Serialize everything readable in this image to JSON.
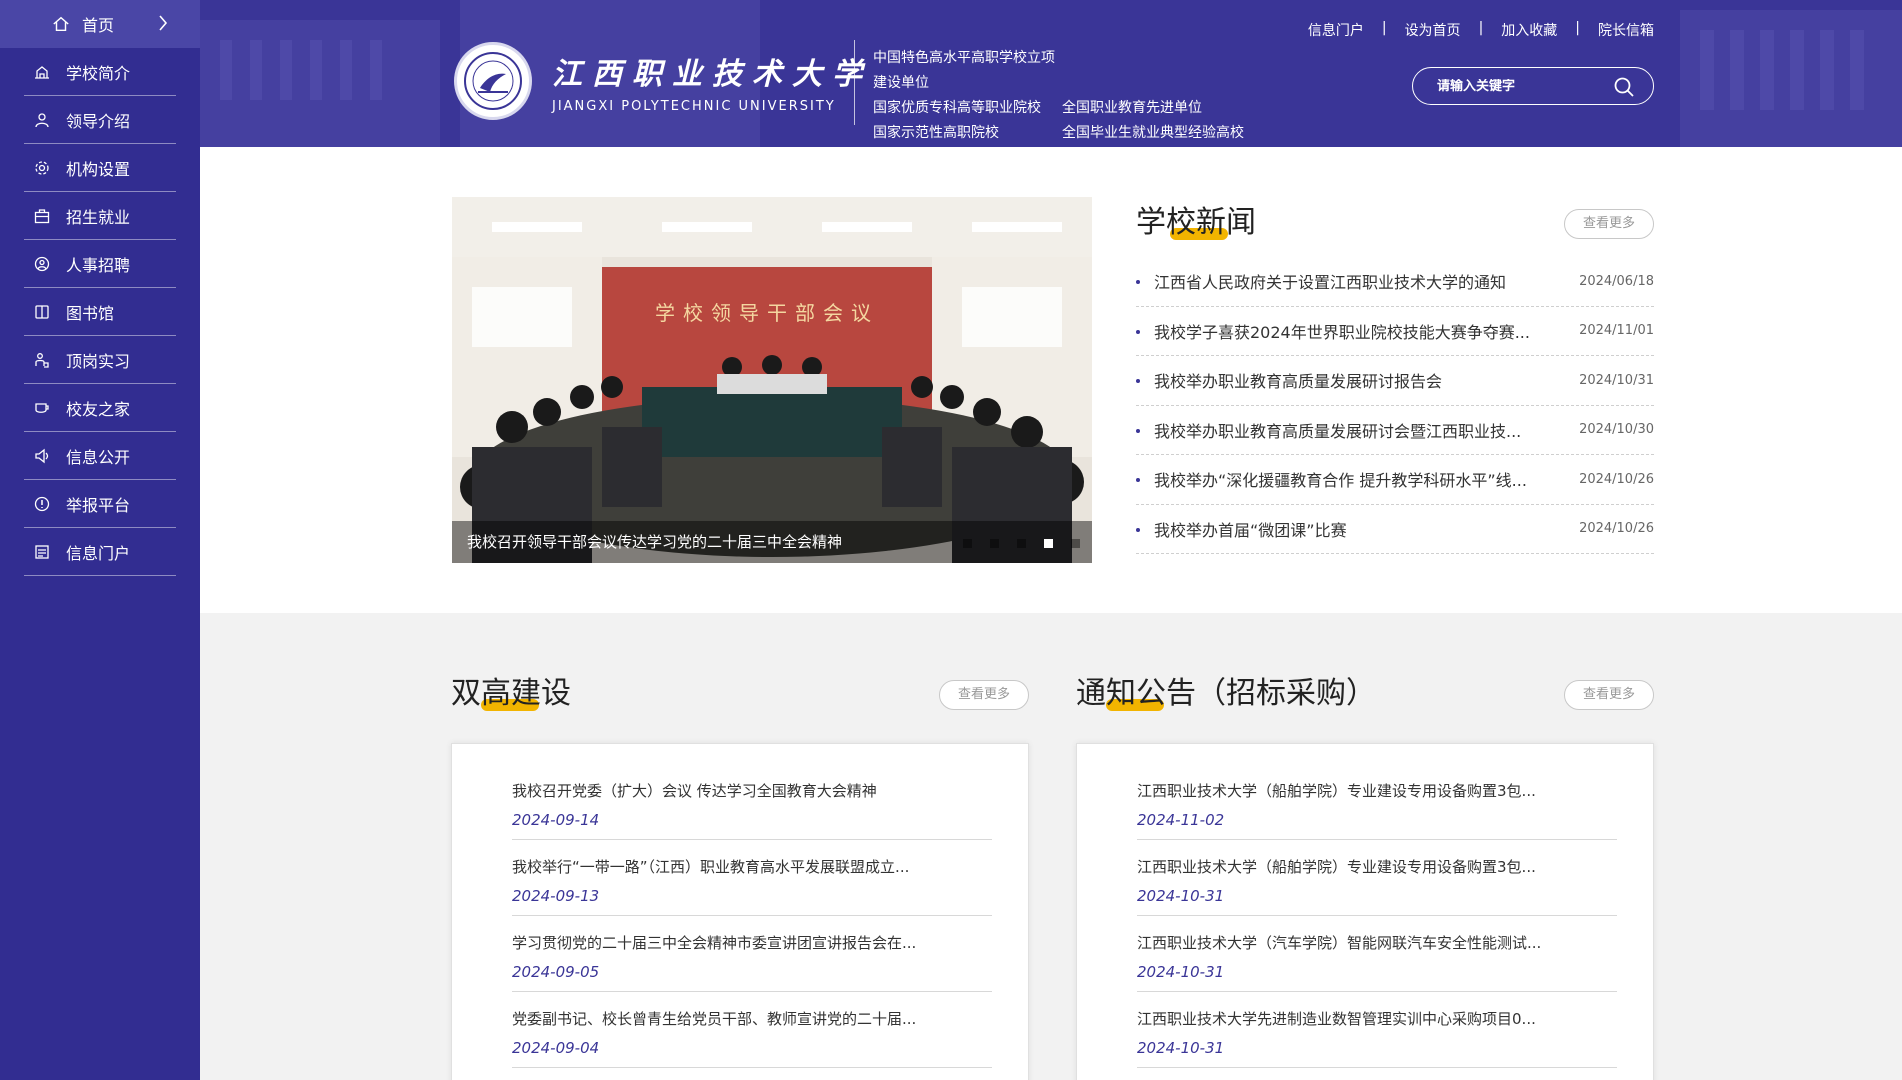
{
  "sidebar": {
    "home_label": "首页",
    "items": [
      {
        "label": "学校简介",
        "icon": "building-icon"
      },
      {
        "label": "领导介绍",
        "icon": "person-icon"
      },
      {
        "label": "机构设置",
        "icon": "gear-icon"
      },
      {
        "label": "招生就业",
        "icon": "briefcase-icon"
      },
      {
        "label": "人事招聘",
        "icon": "user-circle-icon"
      },
      {
        "label": "图书馆",
        "icon": "book-icon"
      },
      {
        "label": "顶岗实习",
        "icon": "worker-icon"
      },
      {
        "label": "校友之家",
        "icon": "cup-icon"
      },
      {
        "label": "信息公开",
        "icon": "speaker-icon"
      },
      {
        "label": "举报平台",
        "icon": "alert-icon"
      },
      {
        "label": "信息门户",
        "icon": "portal-icon"
      }
    ]
  },
  "header": {
    "logo_cn": "江西职业技术大学",
    "logo_en": "JIANGXI POLYTECHNIC UNIVERSITY",
    "honors": [
      [
        "中国特色高水平高职学校立项建设单位",
        ""
      ],
      [
        "国家优质专科高等职业院校",
        "全国职业教育先进单位"
      ],
      [
        "国家示范性高职院校",
        "全国毕业生就业典型经验高校"
      ]
    ],
    "top_links": [
      "信息门户",
      "设为首页",
      "加入收藏",
      "院长信箱"
    ],
    "separator": "|",
    "search_placeholder": "请输入关键字"
  },
  "slider": {
    "caption": "我校召开领导干部会议传达学习党的二十届三中全会精神",
    "banner_text": "学校领导干部会议",
    "dots": 5,
    "active_dot": 4
  },
  "news": {
    "title": "学校新闻",
    "more": "查看更多",
    "items": [
      {
        "title": "江西省人民政府关于设置江西职业技术大学的通知",
        "date": "2024/06/18"
      },
      {
        "title": "我校学子喜获2024年世界职业院校技能大赛争夺赛...",
        "date": "2024/11/01"
      },
      {
        "title": "我校举办职业教育高质量发展研讨报告会",
        "date": "2024/10/31"
      },
      {
        "title": "我校举办职业教育高质量发展研讨会暨江西职业技...",
        "date": "2024/10/30"
      },
      {
        "title": "我校举办“深化援疆教育合作 提升教学科研水平”线...",
        "date": "2024/10/26"
      },
      {
        "title": "我校举办首届“微团课”比赛",
        "date": "2024/10/26"
      }
    ]
  },
  "shuanggao": {
    "title": "双高建设",
    "more": "查看更多",
    "items": [
      {
        "title": "我校召开党委（扩大）会议 传达学习全国教育大会精神",
        "date": "2024-09-14"
      },
      {
        "title": "我校举行“一带一路”（江西）职业教育高水平发展联盟成立...",
        "date": "2024-09-13"
      },
      {
        "title": "学习贯彻党的二十届三中全会精神市委宣讲团宣讲报告会在...",
        "date": "2024-09-05"
      },
      {
        "title": "党委副书记、校长曾青生给党员干部、教师宣讲党的二十届...",
        "date": "2024-09-04"
      }
    ]
  },
  "notice": {
    "title": "通知公告（招标采购）",
    "more": "查看更多",
    "items": [
      {
        "title": "江西职业技术大学（船舶学院）专业建设专用设备购置3包...",
        "date": "2024-11-02"
      },
      {
        "title": "江西职业技术大学（船舶学院）专业建设专用设备购置3包...",
        "date": "2024-10-31"
      },
      {
        "title": "江西职业技术大学（汽车学院）智能网联汽车安全性能测试...",
        "date": "2024-10-31"
      },
      {
        "title": "江西职业技术大学先进制造业数智管理实训中心采购项目0...",
        "date": "2024-10-31"
      }
    ]
  },
  "colors": {
    "brand": "#322d91",
    "accent": "#f2b400"
  }
}
